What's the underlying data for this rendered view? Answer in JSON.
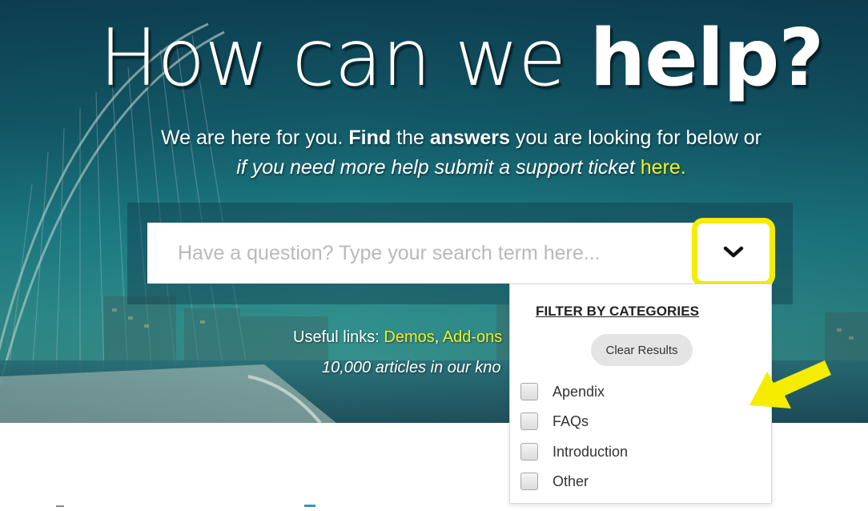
{
  "hero": {
    "title_light": "How can we ",
    "title_bold": "help?",
    "subtitle": {
      "line1_a": "We are here for you. ",
      "line1_b": "Find",
      "line1_c": " the ",
      "line1_d": "answers",
      "line1_e": " you are looking for below or",
      "line2_a": "if you need more help submit a support ticket ",
      "line2_link": "here."
    }
  },
  "search": {
    "placeholder": "Have a question? Type your search term here...",
    "toggle_icon": "chevron-down-icon",
    "highlight_color": "#f5ec00"
  },
  "useful_links": {
    "label": "Useful links: ",
    "links": [
      "Demos",
      "Add-ons"
    ],
    "separator": ", "
  },
  "articles_text": "10,000 articles in our kno",
  "filter": {
    "heading": "FILTER BY CATEGORIES",
    "clear_label": "Clear Results",
    "categories": [
      "Apendix",
      "FAQs",
      "Introduction",
      "Other"
    ]
  },
  "colors": {
    "link": "#f2f020",
    "annotation_arrow": "#f5ec00"
  }
}
